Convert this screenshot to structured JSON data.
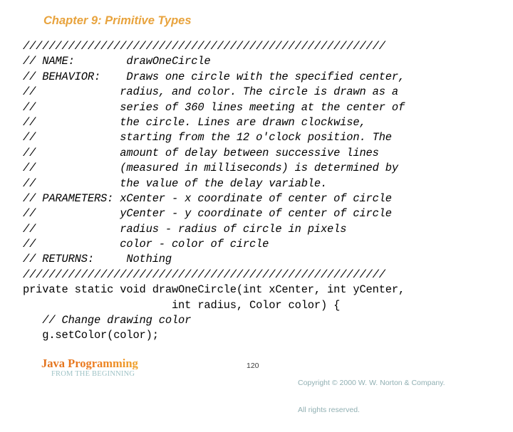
{
  "slide": {
    "title": "Chapter 9: Primitive Types",
    "title_color": "#e8a33d",
    "background_color": "#ffffff"
  },
  "code": {
    "font": "monospace",
    "color": "#000000",
    "lines": [
      {
        "text": "////////////////////////////////////////////////////////",
        "style": "italic"
      },
      {
        "text": "// NAME:        drawOneCircle",
        "style": "italic"
      },
      {
        "text": "// BEHAVIOR:    Draws one circle with the specified center,",
        "style": "italic"
      },
      {
        "text": "//             radius, and color. The circle is drawn as a",
        "style": "italic"
      },
      {
        "text": "//             series of 360 lines meeting at the center of",
        "style": "italic"
      },
      {
        "text": "//             the circle. Lines are drawn clockwise,",
        "style": "italic"
      },
      {
        "text": "//             starting from the 12 o'clock position. The",
        "style": "italic"
      },
      {
        "text": "//             amount of delay between successive lines",
        "style": "italic"
      },
      {
        "text": "//             (measured in milliseconds) is determined by",
        "style": "italic"
      },
      {
        "text": "//             the value of the delay variable.",
        "style": "italic"
      },
      {
        "text": "// PARAMETERS: xCenter - x coordinate of center of circle",
        "style": "italic"
      },
      {
        "text": "//             yCenter - y coordinate of center of circle",
        "style": "italic"
      },
      {
        "text": "//             radius - radius of circle in pixels",
        "style": "italic"
      },
      {
        "text": "//             color - color of circle",
        "style": "italic"
      },
      {
        "text": "// RETURNS:     Nothing",
        "style": "italic"
      },
      {
        "text": "////////////////////////////////////////////////////////",
        "style": "italic"
      },
      {
        "text": "private static void drawOneCircle(int xCenter, int yCenter,",
        "style": "upright"
      },
      {
        "text": "                       int radius, Color color) {",
        "style": "upright"
      },
      {
        "text": "   // Change drawing color",
        "style": "italic"
      },
      {
        "text": "   g.setColor(color);",
        "style": "upright"
      }
    ]
  },
  "footer": {
    "brand_title": "Java Programming",
    "brand_subtitle": "FROM THE BEGINNING",
    "brand_title_color": "#e2711b",
    "brand_subtitle_color": "#9fc3c6",
    "page_number": "120",
    "copyright_line1": "Copyright © 2000 W. W. Norton & Company.",
    "copyright_line2": "All rights reserved.",
    "copyright_color": "#91b0b3"
  }
}
